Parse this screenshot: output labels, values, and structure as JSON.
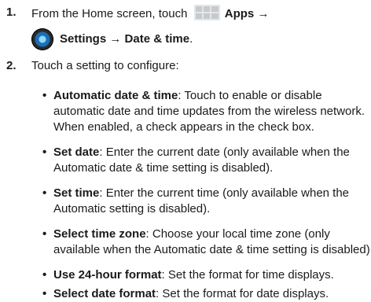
{
  "steps": [
    {
      "number": "1.",
      "line1_prefix": "From the Home screen, touch",
      "apps_label": "Apps",
      "arrow": "→",
      "settings_label": "Settings",
      "date_time_label": "Date & time",
      "period": "."
    },
    {
      "number": "2.",
      "text": "Touch a setting to configure:"
    }
  ],
  "bullets": [
    {
      "bullet": "•",
      "term": "Automatic date & time",
      "desc": ": Touch to enable or disable automatic date and time updates from the wireless network. When enabled, a check appears in the check box."
    },
    {
      "bullet": "•",
      "term": "Set date",
      "desc": ": Enter the current date (only available when the Automatic date & time setting is disabled)."
    },
    {
      "bullet": "•",
      "term": "Set time",
      "desc": ": Enter the current time (only available when the Automatic setting is disabled)."
    },
    {
      "bullet": "•",
      "term": "Select time zone",
      "desc": ": Choose your local time zone (only available when the Automatic date & time setting is disabled)."
    },
    {
      "bullet": "•",
      "term": "Use 24-hour format",
      "desc": ": Set the format for time displays."
    },
    {
      "bullet": "•",
      "term": "Select date format",
      "desc": ": Set the format for date displays."
    }
  ],
  "icons": {
    "apps_icon": "apps-grid-icon",
    "settings_icon": "settings-icon"
  },
  "colors": {
    "text": "#1a1a1a",
    "icon_blue": "#1b6fb5",
    "apps_grey": "#cfd3d6"
  }
}
